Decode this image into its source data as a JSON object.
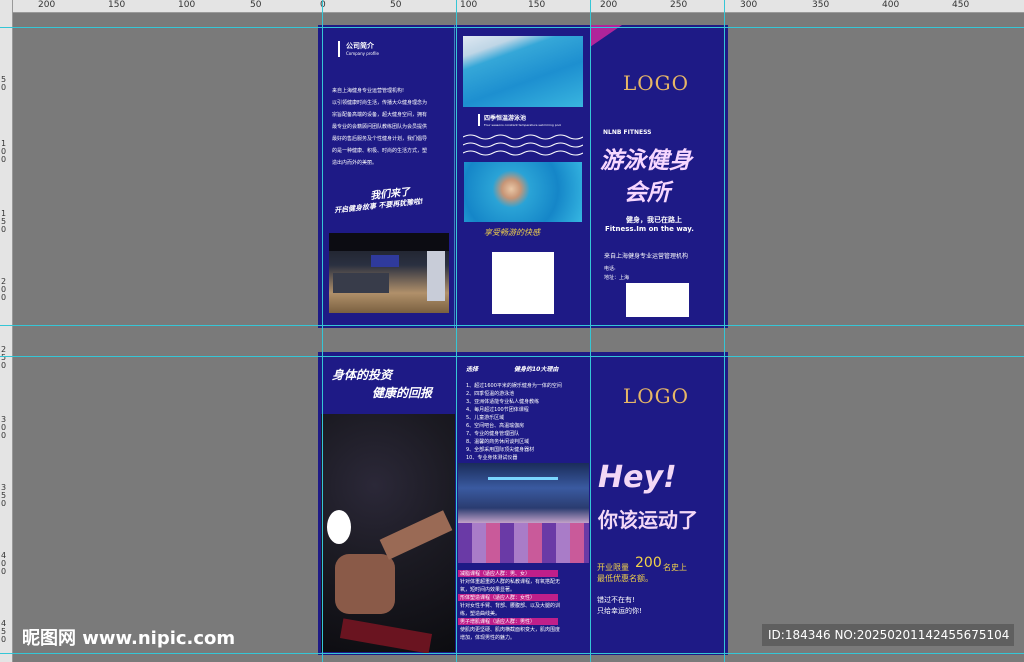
{
  "ruler": {
    "labels": [
      "200",
      "150",
      "100",
      "50",
      "0",
      "50",
      "100",
      "150",
      "200",
      "250",
      "300",
      "350",
      "400",
      "450"
    ],
    "left_labels": [
      "50",
      "100",
      "150",
      "200",
      "250",
      "300",
      "350",
      "400",
      "450"
    ]
  },
  "front": {
    "intro_title": "公司简介",
    "intro_subtitle": "Company profile",
    "intro_lines": [
      "来自上海健身专业运营管理机构!",
      "以引领健康时尚生活，传播大众健身理念为",
      "宗旨配备高端的设备，超大健身空间，拥有",
      "最专业的会籍顾问团队教练团队为会员提供",
      "最好的售后服务及个性健身计划，我们倡导",
      "的是一种健康、积极、时尚的生活方式，塑",
      "造出内而外的美丽。"
    ],
    "slogan1": "我们来了",
    "slogan2": "开启健身故事 不要再犹豫啦!",
    "pool_title": "四季恒温游泳池",
    "pool_sub": "Four seasons constant temperature swimming pool",
    "pool_caption": "享受畅游的快感",
    "logo": "LOGO",
    "brand_en": "NLNB FITNESS",
    "brand_cn_1": "游泳健身",
    "brand_cn_2": "会所",
    "motto_cn": "健身，我已在路上",
    "motto_en": "Fitness.Im on the way.",
    "org": "来自上海健身专业运营管理机构",
    "phone_label": "电话:",
    "address_label": "地址：上海"
  },
  "back": {
    "headline1": "身体的投资",
    "headline2": "健康的回报",
    "reasons_left": "选择",
    "reasons_right": "健身的10大理由",
    "reasons": [
      "1、超过1600平米的娱乐健身为一体的空间",
      "2、四季恒温的游泳池",
      "3、亚洲体适能专业私人健身教练",
      "4、每月超过100节团体课程",
      "5、儿童游乐区域",
      "6、空间吧台、高温瑜伽房",
      "7、专业的健身管理团队",
      "8、温馨的商务休闲谈判区域",
      "9、全部采用国际顶尖健身器材",
      "10、专业身体测试仪器"
    ],
    "course1_title": "减脂课程（适应人群：男、女）",
    "course1_desc": [
      "针对体重超重的人群的私教课程，有氧搭配无",
      "氧，短时间内效果显著。"
    ],
    "course2_title": "形体塑造课程（适应人群：女性）",
    "course2_desc": [
      "针对女性手臂、背部、腰腹部、以及大腿的训",
      "练，塑造曲线美。"
    ],
    "course3_title": "男子增肌课程（适应人群：男性）",
    "course3_desc": [
      "使肌肉更坚硬、肌肉横截面积变大，肌肉围度",
      "增加，体现男性的魅力。"
    ],
    "logo": "LOGO",
    "hey": "Hey!",
    "hey_cn": "你该运动了",
    "limit_pre": "开业限量",
    "limit_num": "200",
    "limit_post": "名史上",
    "limit_line2": "最低优惠名额。",
    "miss1": "错过不在有!",
    "miss2": "只给幸运的你!"
  },
  "watermark": {
    "site": "昵图网 www.nipic.com",
    "id": "ID:184346 NO:20250201142455675104"
  },
  "colors": {
    "panel": "#1e1a86",
    "guide": "#35c6d6",
    "accent": "#c01f8a",
    "logo": "#e7b766"
  }
}
